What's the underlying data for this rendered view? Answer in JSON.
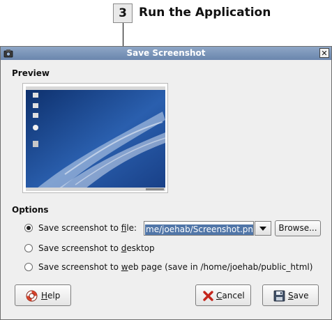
{
  "callout": {
    "step_number": "3",
    "title": "Run the Application"
  },
  "window": {
    "title": "Save Screenshot",
    "close_label": "✕"
  },
  "preview": {
    "label": "Preview"
  },
  "options": {
    "label": "Options",
    "save_to_file_pre": "Save screenshot to ",
    "save_to_file_key": "f",
    "save_to_file_post": "ile:",
    "save_to_desktop_pre": "Save screenshot to ",
    "save_to_desktop_key": "d",
    "save_to_desktop_post": "esktop",
    "save_to_web_pre": "Save screenshot to ",
    "save_to_web_key": "w",
    "save_to_web_post": "eb page (save in /home/joehab/public_html)",
    "selected": "file"
  },
  "file_field": {
    "value": "me/joehab/Screenshot.png"
  },
  "buttons": {
    "browse": "Browse...",
    "help_key": "H",
    "help_rest": "elp",
    "cancel_key": "C",
    "cancel_rest": "ancel",
    "save_key": "S",
    "save_rest": "ave"
  },
  "icons": {
    "app": "screenshot-app-icon",
    "close": "close-icon",
    "dropdown": "chevron-down-icon",
    "help": "help-lifebuoy-icon",
    "cancel": "cancel-x-icon",
    "save": "floppy-disk-icon"
  },
  "colors": {
    "titlebar": "#7a93b8",
    "selection": "#5176a8",
    "desktop_blue": "#1f4f9a"
  }
}
